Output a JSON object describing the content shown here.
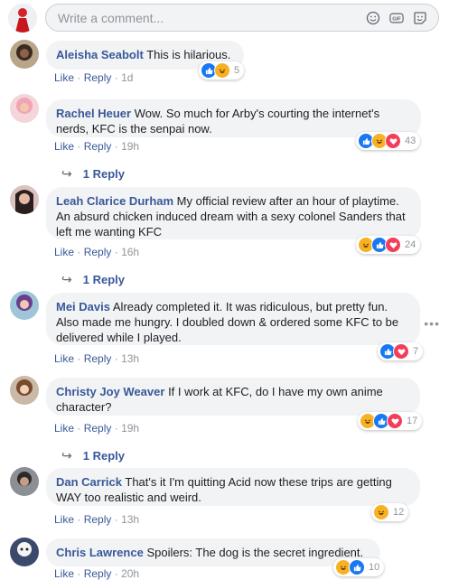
{
  "composer": {
    "placeholder": "Write a comment..."
  },
  "comments": [
    {
      "name": "Aleisha Seabolt",
      "text": "This is hilarious.",
      "actions": [
        "Like",
        "Reply"
      ],
      "time": "1d",
      "reaction_count": "5",
      "replies": ""
    },
    {
      "name": "Rachel Heuer",
      "text": "Wow. So much for Arby's courting the internet's nerds, KFC is the senpai now.",
      "actions": [
        "Like",
        "Reply"
      ],
      "time": "19h",
      "reaction_count": "43",
      "replies": "1 Reply"
    },
    {
      "name": "Leah Clarice Durham",
      "text": "My official review after an hour of playtime. An absurd chicken induced dream with a sexy colonel Sanders that left me wanting KFC",
      "actions": [
        "Like",
        "Reply"
      ],
      "time": "16h",
      "reaction_count": "24",
      "replies": "1 Reply"
    },
    {
      "name": "Mei Davis",
      "text": "Already completed it. It was ridiculous, but pretty fun. Also made me hungry. I doubled down & ordered some KFC to be delivered while I played.",
      "actions": [
        "Like",
        "Reply"
      ],
      "time": "13h",
      "reaction_count": "7",
      "replies": ""
    },
    {
      "name": "Christy Joy Weaver",
      "text": "If I work at KFC, do I have my own anime character?",
      "actions": [
        "Like",
        "Reply"
      ],
      "time": "19h",
      "reaction_count": "17",
      "replies": "1 Reply"
    },
    {
      "name": "Dan Carrick",
      "text": "That's it I'm quitting Acid now these trips are getting WAY too realistic and weird.",
      "actions": [
        "Like",
        "Reply"
      ],
      "time": "13h",
      "reaction_count": "12",
      "replies": ""
    },
    {
      "name": "Chris Lawrence",
      "text": "Spoilers: The dog is the secret ingredient.",
      "actions": [
        "Like",
        "Reply"
      ],
      "time": "20h",
      "reaction_count": "10",
      "replies": ""
    }
  ],
  "colors": {
    "link": "#385898",
    "bubble": "#f2f3f5",
    "muted": "#90949c",
    "like": "#1877f2",
    "love": "#f33e58",
    "haha": "#f7b125"
  }
}
